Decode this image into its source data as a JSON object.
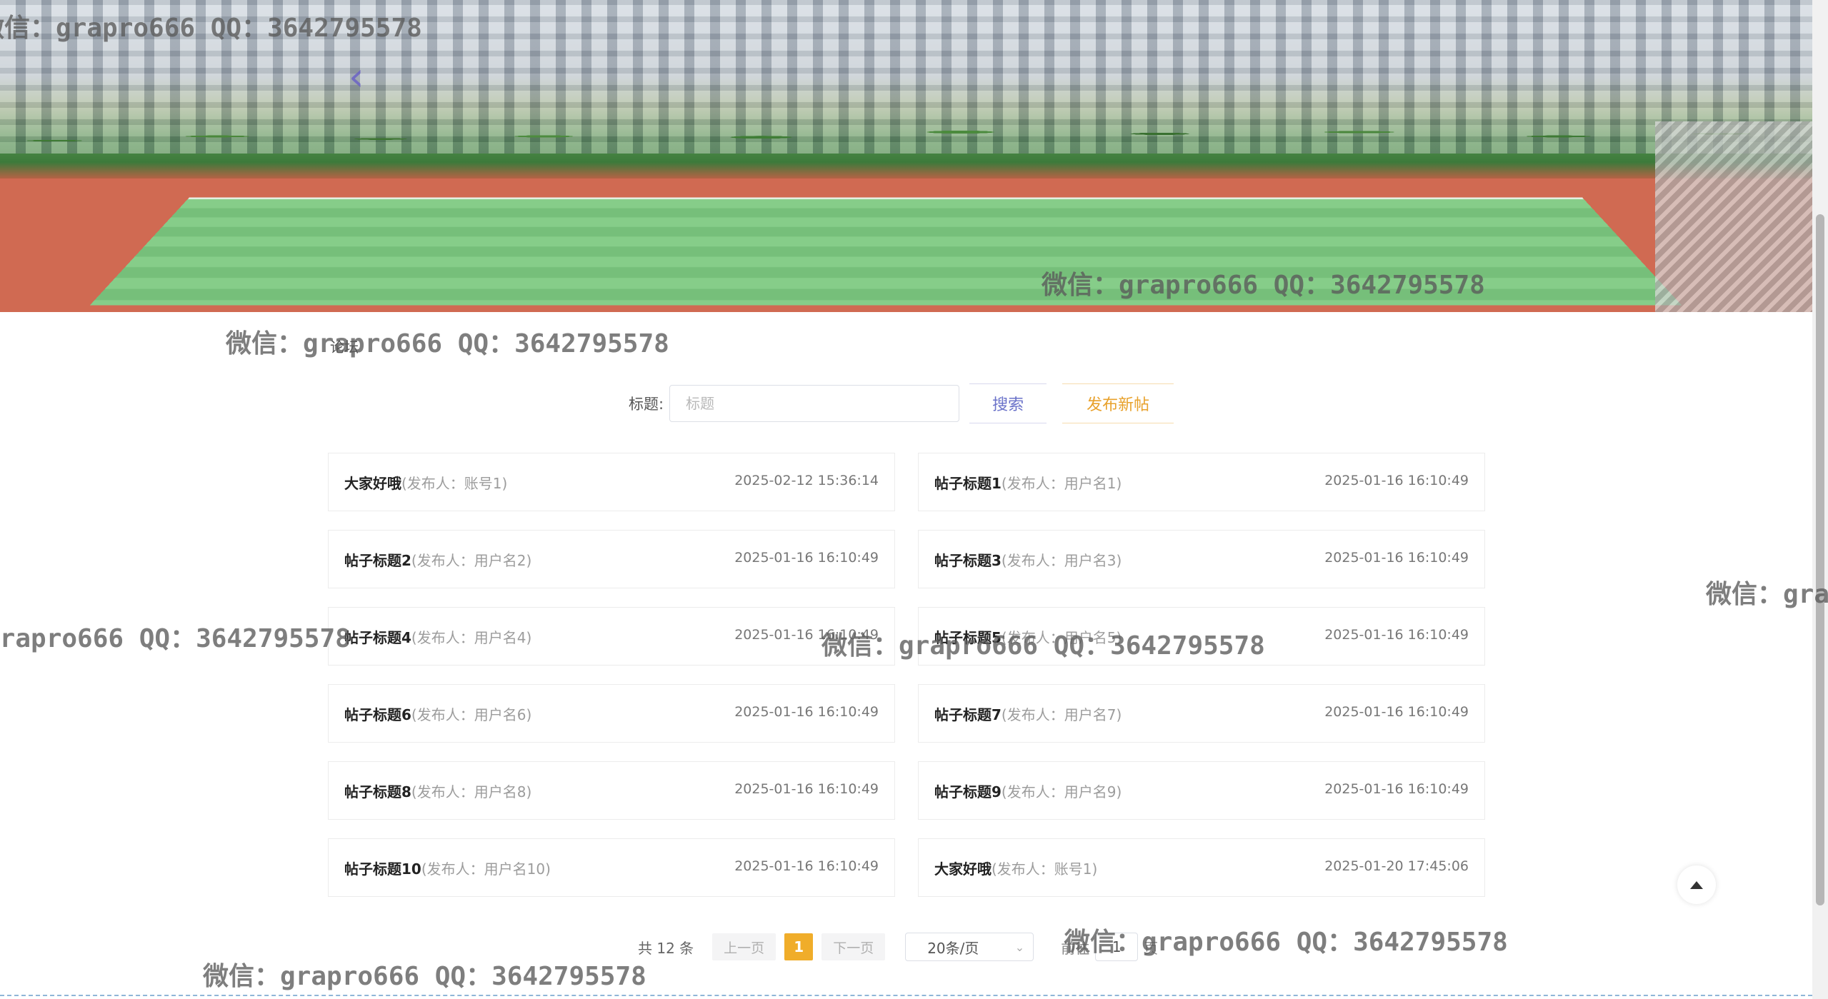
{
  "banner": {
    "prev_icon": "chevron-left-icon"
  },
  "breadcrumb": "论坛",
  "search": {
    "label": "标题:",
    "placeholder": "标题",
    "value": "",
    "search_button": "搜索",
    "publish_button": "发布新帖"
  },
  "posts": [
    {
      "title": "大家好哦",
      "author": "(发布人：账号1)",
      "time": "2025-02-12 15:36:14"
    },
    {
      "title": "帖子标题1",
      "author": "(发布人：用户名1)",
      "time": "2025-01-16 16:10:49"
    },
    {
      "title": "帖子标题2",
      "author": "(发布人：用户名2)",
      "time": "2025-01-16 16:10:49"
    },
    {
      "title": "帖子标题3",
      "author": "(发布人：用户名3)",
      "time": "2025-01-16 16:10:49"
    },
    {
      "title": "帖子标题4",
      "author": "(发布人：用户名4)",
      "time": "2025-01-16 16:10:49"
    },
    {
      "title": "帖子标题5",
      "author": "(发布人：用户名5)",
      "time": "2025-01-16 16:10:49"
    },
    {
      "title": "帖子标题6",
      "author": "(发布人：用户名6)",
      "time": "2025-01-16 16:10:49"
    },
    {
      "title": "帖子标题7",
      "author": "(发布人：用户名7)",
      "time": "2025-01-16 16:10:49"
    },
    {
      "title": "帖子标题8",
      "author": "(发布人：用户名8)",
      "time": "2025-01-16 16:10:49"
    },
    {
      "title": "帖子标题9",
      "author": "(发布人：用户名9)",
      "time": "2025-01-16 16:10:49"
    },
    {
      "title": "帖子标题10",
      "author": "(发布人：用户名10)",
      "time": "2025-01-16 16:10:49"
    },
    {
      "title": "大家好哦",
      "author": "(发布人：账号1)",
      "time": "2025-01-20 17:45:06"
    }
  ],
  "pagination": {
    "total": "共 12 条",
    "prev": "上一页",
    "current": "1",
    "next": "下一页",
    "page_size": "20条/页",
    "goto_label": "前往",
    "goto_value": "1",
    "goto_suffix": "页"
  },
  "watermark": "微信：grapro666 QQ：3642795578"
}
